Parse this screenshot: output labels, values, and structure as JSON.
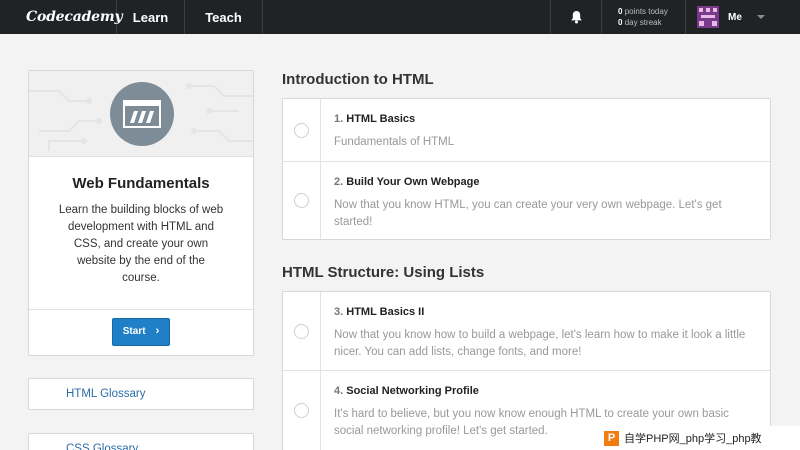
{
  "nav": {
    "logo": "Codecademy",
    "learn": "Learn",
    "teach": "Teach",
    "points_value": "0",
    "points_label": "points today",
    "streak_value": "0",
    "streak_label": "day streak",
    "me_label": "Me"
  },
  "course": {
    "title": "Web Fundamentals",
    "description": "Learn the building blocks of web development with HTML and CSS, and create your own website by the end of the course.",
    "start_label": "Start"
  },
  "glossaries": [
    {
      "label": "HTML Glossary"
    },
    {
      "label": "CSS Glossary"
    }
  ],
  "sections": [
    {
      "title": "Introduction to HTML",
      "lessons": [
        {
          "num": "1.",
          "title": "HTML Basics",
          "text": "Fundamentals of HTML"
        },
        {
          "num": "2.",
          "title": "Build Your Own Webpage",
          "text": "Now that you know HTML, you can create your very own webpage. Let's get started!"
        }
      ]
    },
    {
      "title": "HTML Structure: Using Lists",
      "lessons": [
        {
          "num": "3.",
          "title": "HTML Basics II",
          "text": "Now that you know how to build a webpage, let's learn how to make it look a little nicer. You can add lists, change fonts, and more!"
        },
        {
          "num": "4.",
          "title": "Social Networking Profile",
          "text": "It's hard to believe, but you now know enough HTML to create your own basic social networking profile! Let's get started."
        }
      ]
    }
  ],
  "watermark": {
    "badge": "P",
    "text": "自学PHP网_php学习_php教"
  },
  "colors": {
    "nav_bg": "#1f2326",
    "accent": "#1f80c8",
    "link": "#2b6ca8"
  },
  "icons": [
    "bell-icon",
    "avatar",
    "chevron-down-icon",
    "course-icon",
    "chevron-right-icon",
    "radio-circle"
  ]
}
